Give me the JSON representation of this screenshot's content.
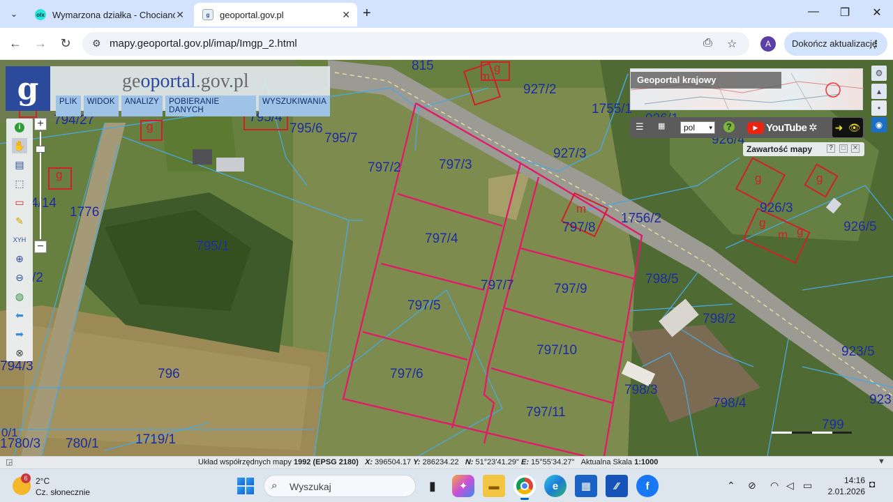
{
  "browser": {
    "tabs": [
      {
        "title": "Wymarzona działka - Chocianó",
        "favicon": "olx-icon",
        "active": false
      },
      {
        "title": "geoportal.gov.pl",
        "favicon": "geoportal-icon",
        "active": true
      }
    ],
    "url": "mapy.geoportal.gov.pl/imap/Imgp_2.html",
    "profile_initial": "A",
    "update_label": "Dokończ aktualizację"
  },
  "geoportal": {
    "brand_prefix": "ge",
    "brand_o": "o",
    "brand_accent": "portal",
    "brand_suffix": ".gov.pl",
    "menu": [
      "PLIK",
      "WIDOK",
      "ANALIZY",
      "POBIERANIE DANYCH",
      "WYSZUKIWANIA"
    ],
    "krajowy_title": "Geoportal krajowy",
    "language": "pol",
    "youtube": "YouTube",
    "contents_title": "Zawartość mapy",
    "colors": {
      "parcel_line": "#d81b60",
      "cadastre_line": "#4aa8e0",
      "label": "#1a2a9c",
      "building": "#d0202a"
    }
  },
  "map": {
    "parcel_labels": [
      "815",
      "927/2",
      "1755/1",
      "926/1",
      "926/4",
      "794/27",
      "795/4",
      "795/6",
      "795/7",
      "797/2",
      "797/3",
      "927/3",
      "4/14",
      "1776",
      "1756/2",
      "926/3",
      "926/5",
      "797/8",
      "797/4",
      "795/1",
      "798/5",
      "/2",
      "797/7",
      "797/9",
      "797/5",
      "798/2",
      "797/10",
      "923/5",
      "794/3",
      "796",
      "797/6",
      "798/3",
      "798/4",
      "923",
      "797/11",
      "799",
      "1719/1",
      "780/1",
      "1780/3",
      "0/1"
    ],
    "building_labels": [
      "m",
      "g",
      "m",
      "g",
      "g",
      "g",
      "g",
      "m",
      "g",
      "g"
    ]
  },
  "statusbar": {
    "crs_label": "Układ współrzędnych mapy",
    "crs_value": "1992 (EPSG 2180)",
    "x_label": "X:",
    "x_value": "396504.17",
    "y_label": "Y:",
    "y_value": "286234.22",
    "n_label": "N:",
    "n_value": "51°23'41.29\"",
    "e_label": "E:",
    "e_value": "15°55'34.27\"",
    "scale_label": "Aktualna Skala",
    "scale_value": "1:1000"
  },
  "taskbar": {
    "temperature": "2°C",
    "weather": "Cz. słonecznie",
    "weather_badge": "6",
    "search_placeholder": "Wyszukaj",
    "time": "14:16",
    "date": "2.01.2026"
  }
}
